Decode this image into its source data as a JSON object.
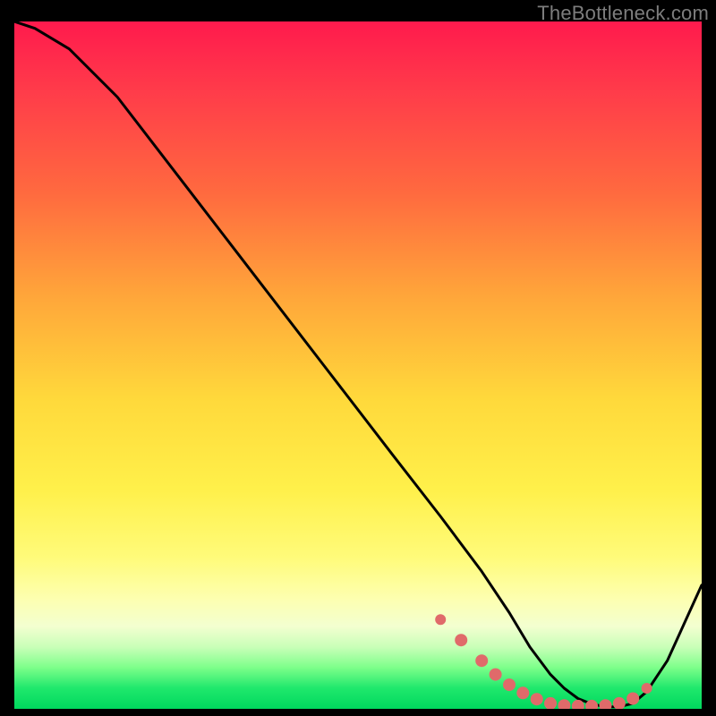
{
  "watermark": "TheBottleneck.com",
  "chart_data": {
    "type": "line",
    "title": "",
    "xlabel": "",
    "ylabel": "",
    "xlim": [
      0,
      100
    ],
    "ylim": [
      0,
      100
    ],
    "series": [
      {
        "name": "bottleneck-curve",
        "x": [
          0,
          3,
          8,
          15,
          25,
          35,
          45,
          55,
          62,
          68,
          72,
          75,
          78,
          80,
          82,
          84,
          86,
          88,
          90,
          92,
          95,
          100
        ],
        "y": [
          100,
          99,
          96,
          89,
          76,
          63,
          50,
          37,
          28,
          20,
          14,
          9,
          5,
          3,
          1.5,
          0.7,
          0.3,
          0.3,
          0.8,
          2.5,
          7,
          18
        ]
      }
    ],
    "markers": {
      "name": "highlight-dots",
      "x": [
        62,
        65,
        68,
        70,
        72,
        74,
        76,
        78,
        80,
        82,
        84,
        86,
        88,
        90,
        92
      ],
      "y": [
        13,
        10,
        7,
        5,
        3.5,
        2.3,
        1.4,
        0.8,
        0.5,
        0.4,
        0.4,
        0.5,
        0.8,
        1.5,
        3
      ]
    },
    "colors": {
      "curve": "#000000",
      "markers": "#e06a6a"
    }
  }
}
